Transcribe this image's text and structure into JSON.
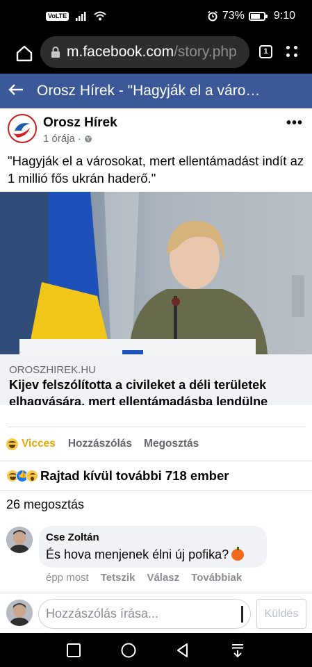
{
  "status_bar": {
    "volte": "VoLTE",
    "battery_percent": "73%",
    "battery_level": 0.73,
    "time": "9:10"
  },
  "browser": {
    "url_domain": "m.facebook.com",
    "url_path": "/story.php",
    "tab_count": "1"
  },
  "header": {
    "title": "Orosz Hírek - \"Hagyják el a váro…"
  },
  "post": {
    "page_name": "Orosz Hírek",
    "time": "1 órája",
    "time_separator": "·",
    "more": "•••",
    "text": "\"Hagyják el a városokat, mert ellentámadást indít az 1 millió fős ukrán haderő.\"",
    "link": {
      "domain": "OROSZHIREK.HU",
      "title": "Kijev felszólította a civileket a déli területek elhagyására, mert ellentámadásba lendülne"
    },
    "actions": {
      "reaction_label": "Vicces",
      "comment_label": "Hozzászólás",
      "share_label": "Megosztás"
    },
    "reactions_summary": "Rajtad kívül további 718 ember",
    "shares": "26 megosztás"
  },
  "comments": [
    {
      "author": "Cse Zoltán",
      "text": "És hova menjenek élni új pofika?",
      "time": "épp most",
      "like_label": "Tetszik",
      "reply_label": "Válasz",
      "more_label": "Továbbiak"
    }
  ],
  "composer": {
    "placeholder": "Hozzászólás írása...",
    "send_label": "Küldés"
  },
  "colors": {
    "fb_blue": "#3b5998",
    "haha_yellow": "#f7c844",
    "vicces_text": "#e6a700"
  }
}
